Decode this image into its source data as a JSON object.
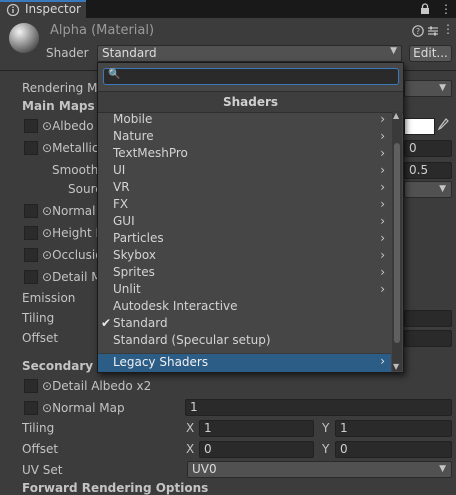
{
  "tab": {
    "label": "Inspector"
  },
  "header": {
    "title": "Alpha (Material)",
    "shader_label": "Shader",
    "shader_value": "Standard",
    "edit_label": "Edit..."
  },
  "properties": {
    "rendering_mode": "Rendering Mo",
    "main_maps": "Main Maps",
    "albedo": "Albedo",
    "metallic": "Metallic",
    "metallic_value": "0",
    "smoothness": "Smoothn",
    "smoothness_value": "0.5",
    "source": "Sourc",
    "normal_map": "Normal I",
    "height_map": "Height M",
    "occlusion": "Occlusio",
    "detail_mask": "Detail M",
    "emission": "Emission",
    "tiling": "Tiling",
    "offset": "Offset",
    "secondary_maps": "Secondary M",
    "detail_albedo": "Detail Albedo x2",
    "normal_map2": "Normal Map",
    "normal_map2_value": "1",
    "tiling2": "Tiling",
    "offset2": "Offset",
    "tiling_x": "1",
    "tiling_y": "1",
    "offset_x": "0",
    "offset_y": "0",
    "x_label": "X",
    "y_label": "Y",
    "uv_set": "UV Set",
    "uv_set_value": "UV0",
    "forward": "Forward Rendering Options"
  },
  "popup": {
    "header": "Shaders",
    "search_value": "",
    "items": [
      {
        "label": "Mobile",
        "submenu": true
      },
      {
        "label": "Nature",
        "submenu": true
      },
      {
        "label": "TextMeshPro",
        "submenu": true
      },
      {
        "label": "UI",
        "submenu": true
      },
      {
        "label": "VR",
        "submenu": true
      },
      {
        "label": "FX",
        "submenu": true
      },
      {
        "label": "GUI",
        "submenu": true
      },
      {
        "label": "Particles",
        "submenu": true
      },
      {
        "label": "Skybox",
        "submenu": true
      },
      {
        "label": "Sprites",
        "submenu": true
      },
      {
        "label": "Unlit",
        "submenu": true
      },
      {
        "label": "Autodesk Interactive",
        "submenu": false
      },
      {
        "label": "Standard",
        "submenu": false,
        "checked": true
      },
      {
        "label": "Standard (Specular setup)",
        "submenu": false
      }
    ],
    "highlighted": "Legacy Shaders",
    "check_glyph": "✔",
    "chevron_glyph": "›"
  },
  "colors": {
    "accent": "#3a79bb",
    "highlight": "#2c5d87",
    "bg": "#3c3c3c"
  }
}
